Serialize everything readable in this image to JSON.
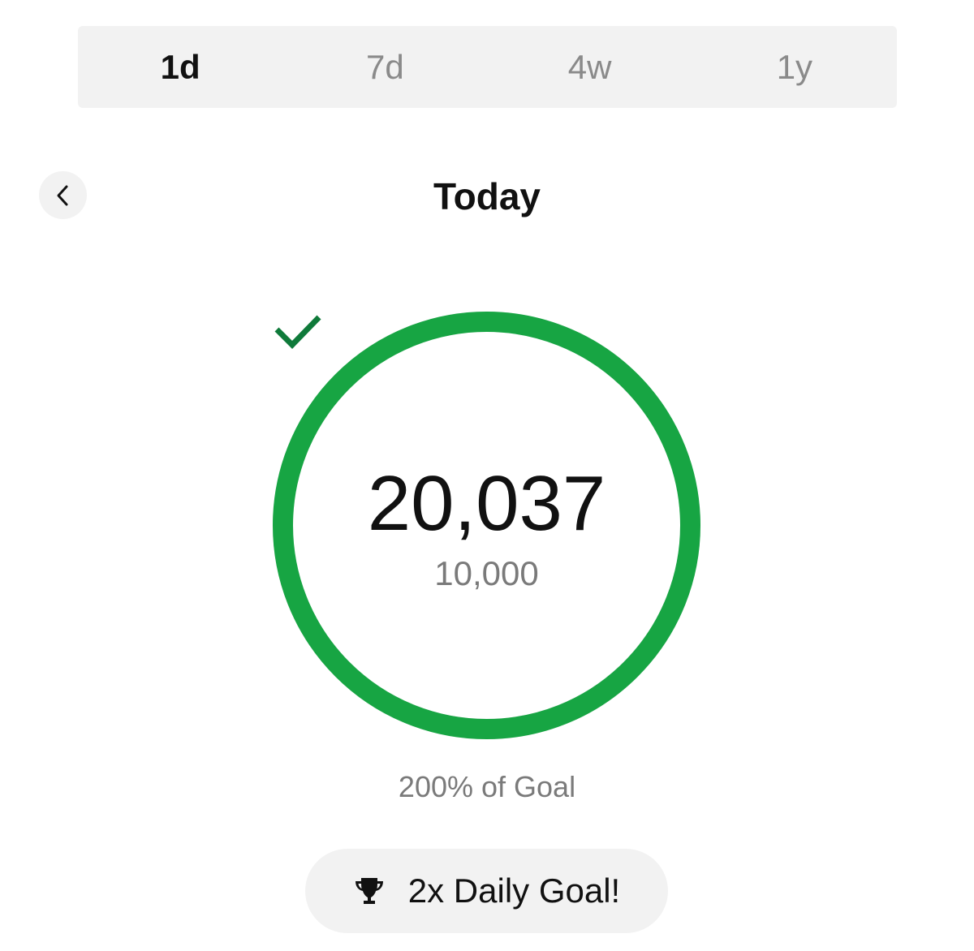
{
  "tabs": [
    {
      "label": "1d",
      "active": true
    },
    {
      "label": "7d",
      "active": false
    },
    {
      "label": "4w",
      "active": false
    },
    {
      "label": "1y",
      "active": false
    }
  ],
  "header": {
    "back_icon": "chevron-left-icon",
    "title": "Today"
  },
  "progress": {
    "steps": "20,037",
    "goal": "10,000",
    "ring_fill_fraction": 1.0,
    "ring_color": "#17a543",
    "check_color": "#0f7a3a",
    "check_icon": "checkmark-icon",
    "percent_label": "200% of Goal"
  },
  "badge": {
    "icon": "trophy-icon",
    "label": "2x Daily Goal!"
  },
  "colors": {
    "background": "#ffffff",
    "surface": "#f2f2f2",
    "text_primary": "#111111",
    "text_secondary": "#7a7a7a"
  }
}
